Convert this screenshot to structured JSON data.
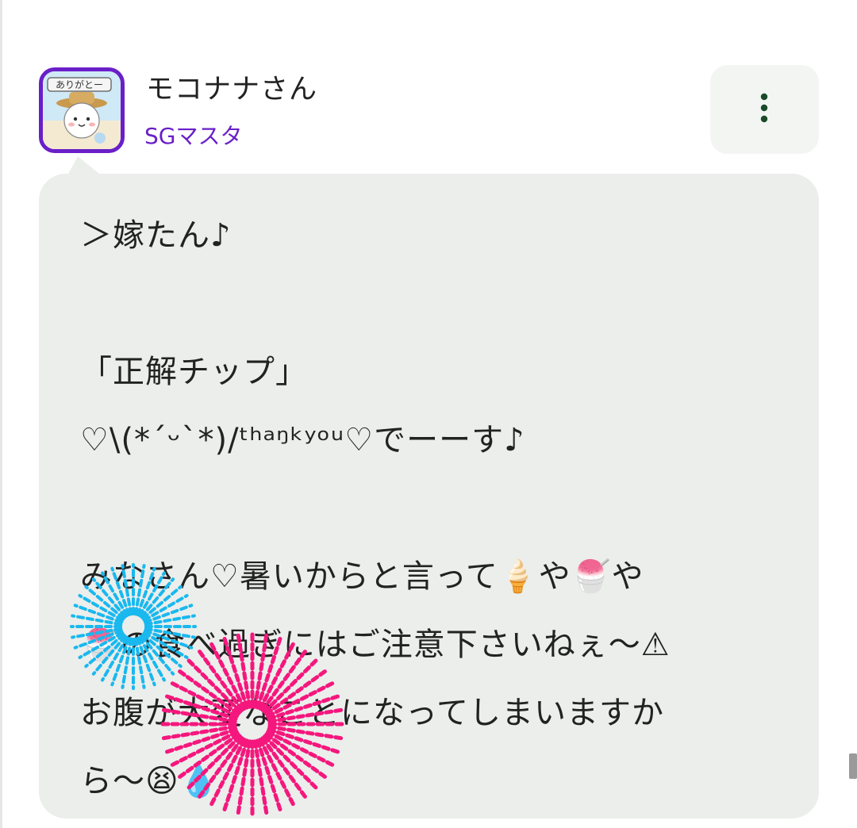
{
  "post": {
    "author": {
      "name": "モコナナさん",
      "rank": "SGマスタ",
      "avatar_text": "ありがとー"
    },
    "menu_icon": "more-vertical-icon",
    "colors": {
      "rank": "#6a1fc8",
      "bubble": "#ebeeeb",
      "menu_dots": "#1b4a2a",
      "firework_blue": "#19b8ef",
      "firework_pink": "#f5177d"
    },
    "message": {
      "line1": "＞嫁たん♪",
      "line2": "「正解チップ」",
      "line3": "♡\\(*´ᵕ`*)/ᵗʰᵃᵑᵏʸᵒᵘ♡でーーす♪",
      "line4": "みなさん♡暑いからと言って🍦や🍧や",
      "line5": "🍧の食べ過ぎにはご注意下さいねぇ〜⚠",
      "line6": "お腹が大変なことになってしまいますか",
      "line7": "ら〜😫💧"
    },
    "stickers": [
      "firework-blue",
      "firework-pink"
    ]
  }
}
